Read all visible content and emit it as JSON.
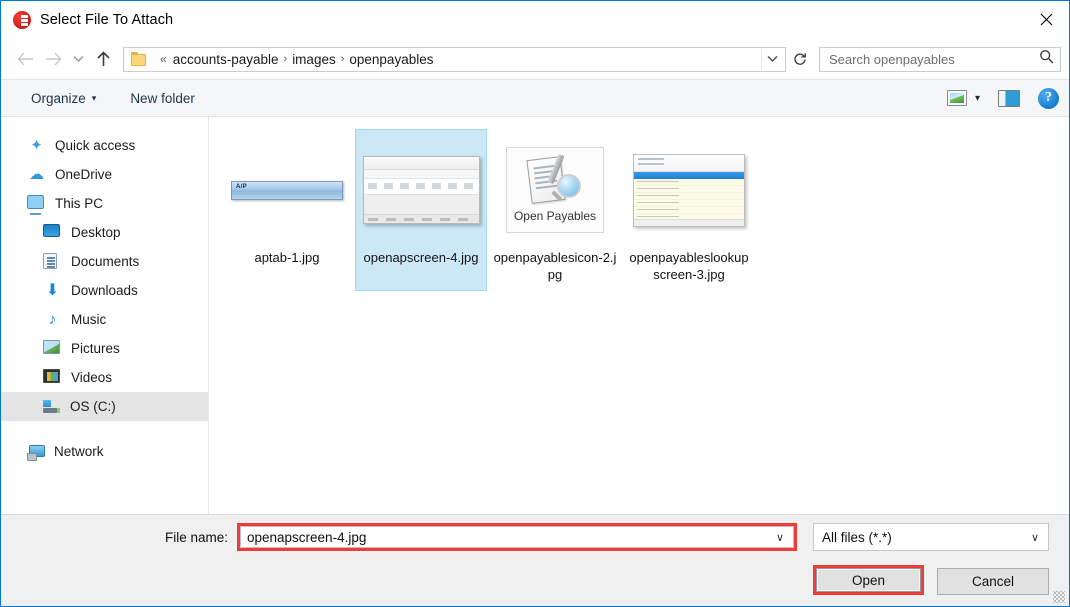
{
  "window": {
    "title": "Select File To Attach",
    "app_icon": "red-circle-icon",
    "close_label": "✕",
    "accent_color": "#0078d7"
  },
  "nav": {
    "back_icon": "arrow-left-icon",
    "forward_icon": "arrow-right-icon",
    "recent_icon": "chevron-down-icon",
    "up_icon": "arrow-up-icon",
    "breadcrumb_prefix": "«",
    "breadcrumb": [
      "accounts-payable",
      "images",
      "openpayables"
    ],
    "breadcrumb_separator": "›",
    "dropdown_icon": "chevron-down-icon",
    "refresh_icon": "refresh-icon"
  },
  "search": {
    "placeholder": "Search openpayables",
    "value": "",
    "icon": "search-icon"
  },
  "toolbar": {
    "organize_label": "Organize",
    "organize_caret": "▾",
    "new_folder_label": "New folder",
    "view_icon": "picture-view-icon",
    "view_caret": "▾",
    "pane_icon": "preview-pane-icon",
    "help_label": "?"
  },
  "sidebar": {
    "items": [
      {
        "label": "Quick access",
        "icon": "star-icon",
        "indent": false,
        "selected": false
      },
      {
        "label": "OneDrive",
        "icon": "cloud-icon",
        "indent": false,
        "selected": false
      },
      {
        "label": "This PC",
        "icon": "computer-icon",
        "indent": false,
        "selected": false
      },
      {
        "label": "Desktop",
        "icon": "desktop-icon",
        "indent": true,
        "selected": false
      },
      {
        "label": "Documents",
        "icon": "document-icon",
        "indent": true,
        "selected": false
      },
      {
        "label": "Downloads",
        "icon": "download-icon",
        "indent": true,
        "selected": false
      },
      {
        "label": "Music",
        "icon": "music-note-icon",
        "indent": true,
        "selected": false
      },
      {
        "label": "Pictures",
        "icon": "picture-icon",
        "indent": true,
        "selected": false
      },
      {
        "label": "Videos",
        "icon": "video-icon",
        "indent": true,
        "selected": false
      },
      {
        "label": "OS (C:)",
        "icon": "hard-drive-icon",
        "indent": true,
        "selected": true
      },
      {
        "label": "Network",
        "icon": "network-icon",
        "indent": false,
        "selected": false
      }
    ]
  },
  "files": [
    {
      "name": "aptab-1.jpg",
      "thumb": "ap-tab-thumb",
      "selected": false,
      "thumb_text": "A/P"
    },
    {
      "name": "openapscreen-4.jpg",
      "thumb": "ap-screen-thumb",
      "selected": true,
      "thumb_text": ""
    },
    {
      "name": "openpayablesicon-2.jpg",
      "thumb": "open-payables-icon-thumb",
      "selected": false,
      "thumb_text": "Open Payables"
    },
    {
      "name": "openpayableslookupscreen-3.jpg",
      "thumb": "lookup-screen-thumb",
      "selected": false,
      "thumb_text": ""
    }
  ],
  "footer": {
    "filename_label": "File name:",
    "filename_value": "openapscreen-4.jpg",
    "filename_caret": "∨",
    "filetype_value": "All files (*.*)",
    "filetype_caret": "∨",
    "open_label": "Open",
    "cancel_label": "Cancel",
    "highlight_color": "#ec3c3c"
  }
}
